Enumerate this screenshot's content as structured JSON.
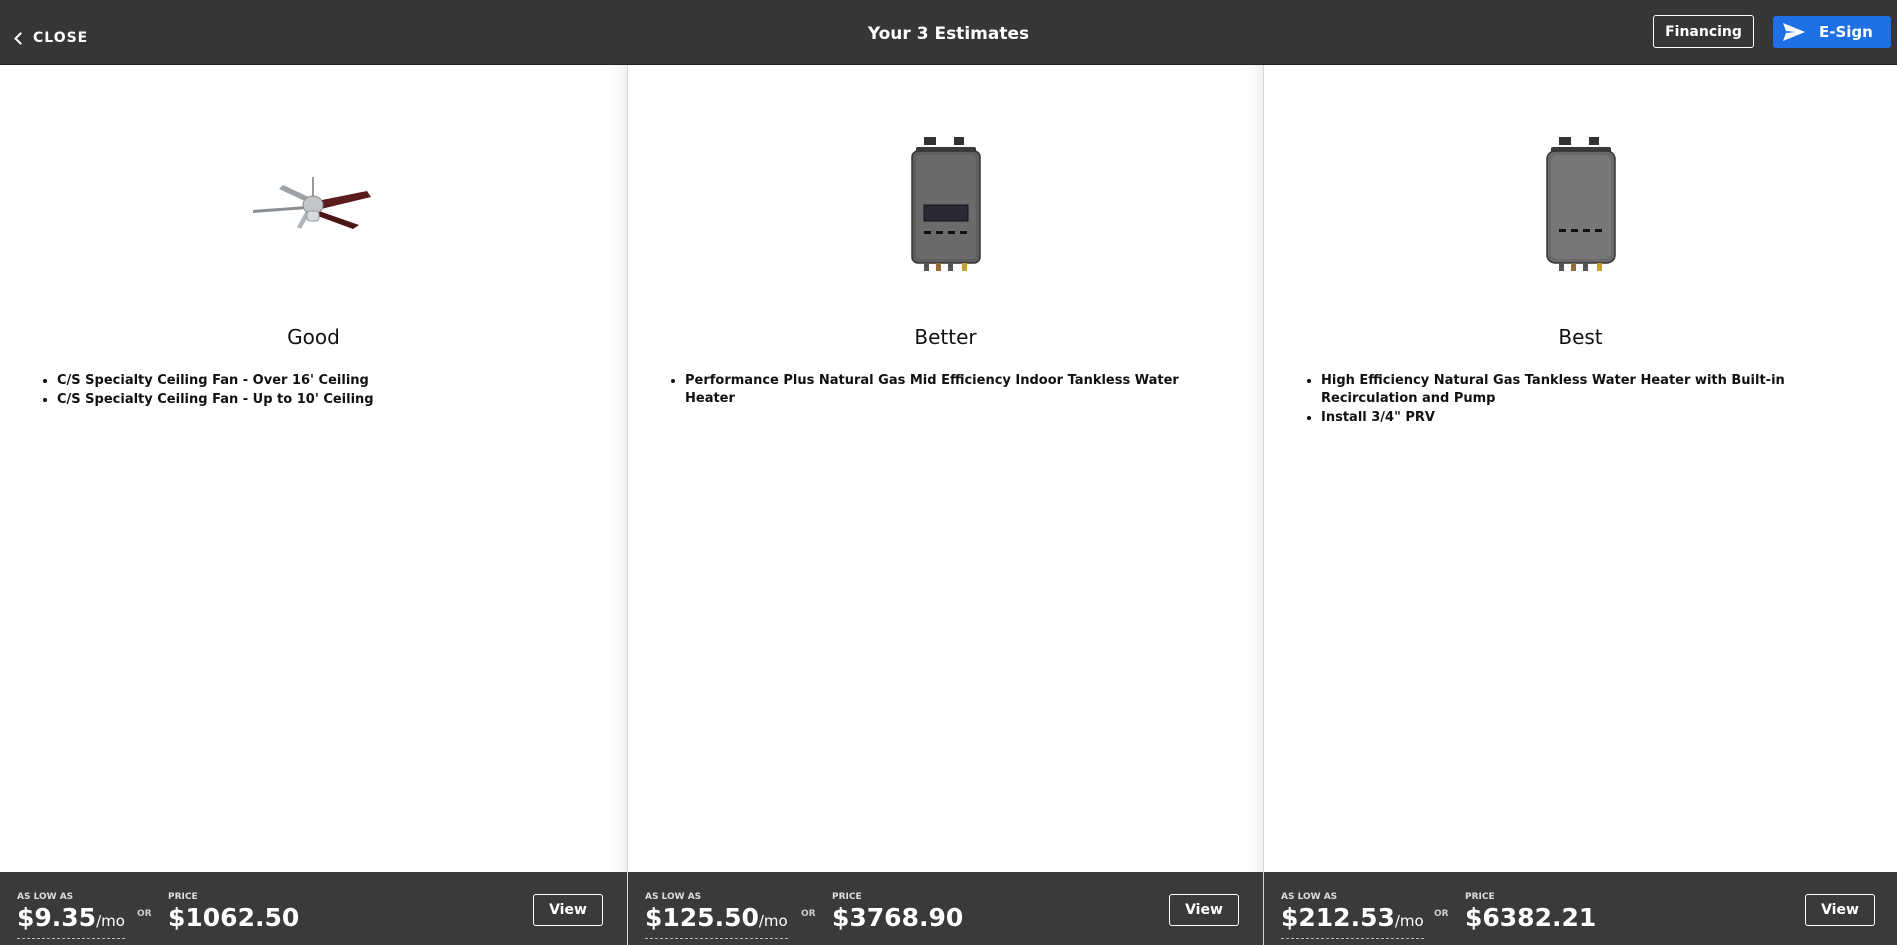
{
  "header": {
    "close_label": "CLOSE",
    "title": "Your 3 Estimates",
    "financing_label": "Financing",
    "esign_label": "E-Sign",
    "esign_color": "#1f6fe5",
    "background_color": "#363636"
  },
  "estimates": [
    {
      "tier": "Good",
      "image_icon": "ceiling-fan-icon",
      "items": [
        "C/S Specialty Ceiling Fan - Over 16' Ceiling",
        "C/S Specialty Ceiling Fan - Up to 10' Ceiling"
      ],
      "monthly_label": "AS LOW AS",
      "monthly_amount": "$9.35",
      "monthly_suffix": "/mo",
      "or_label": "OR",
      "price_label": "PRICE",
      "price": "$1062.50",
      "view_label": "View"
    },
    {
      "tier": "Better",
      "image_icon": "tankless-water-heater-icon",
      "items": [
        "Performance Plus Natural Gas Mid Efficiency Indoor Tankless Water Heater"
      ],
      "monthly_label": "AS LOW AS",
      "monthly_amount": "$125.50",
      "monthly_suffix": "/mo",
      "or_label": "OR",
      "price_label": "PRICE",
      "price": "$3768.90",
      "view_label": "View"
    },
    {
      "tier": "Best",
      "image_icon": "tankless-water-heater-icon",
      "items": [
        "High Efficiency Natural Gas Tankless Water Heater with Built-in Recirculation and Pump",
        "Install 3/4\" PRV"
      ],
      "monthly_label": "AS LOW AS",
      "monthly_amount": "$212.53",
      "monthly_suffix": "/mo",
      "or_label": "OR",
      "price_label": "PRICE",
      "price": "$6382.21",
      "view_label": "View"
    }
  ]
}
